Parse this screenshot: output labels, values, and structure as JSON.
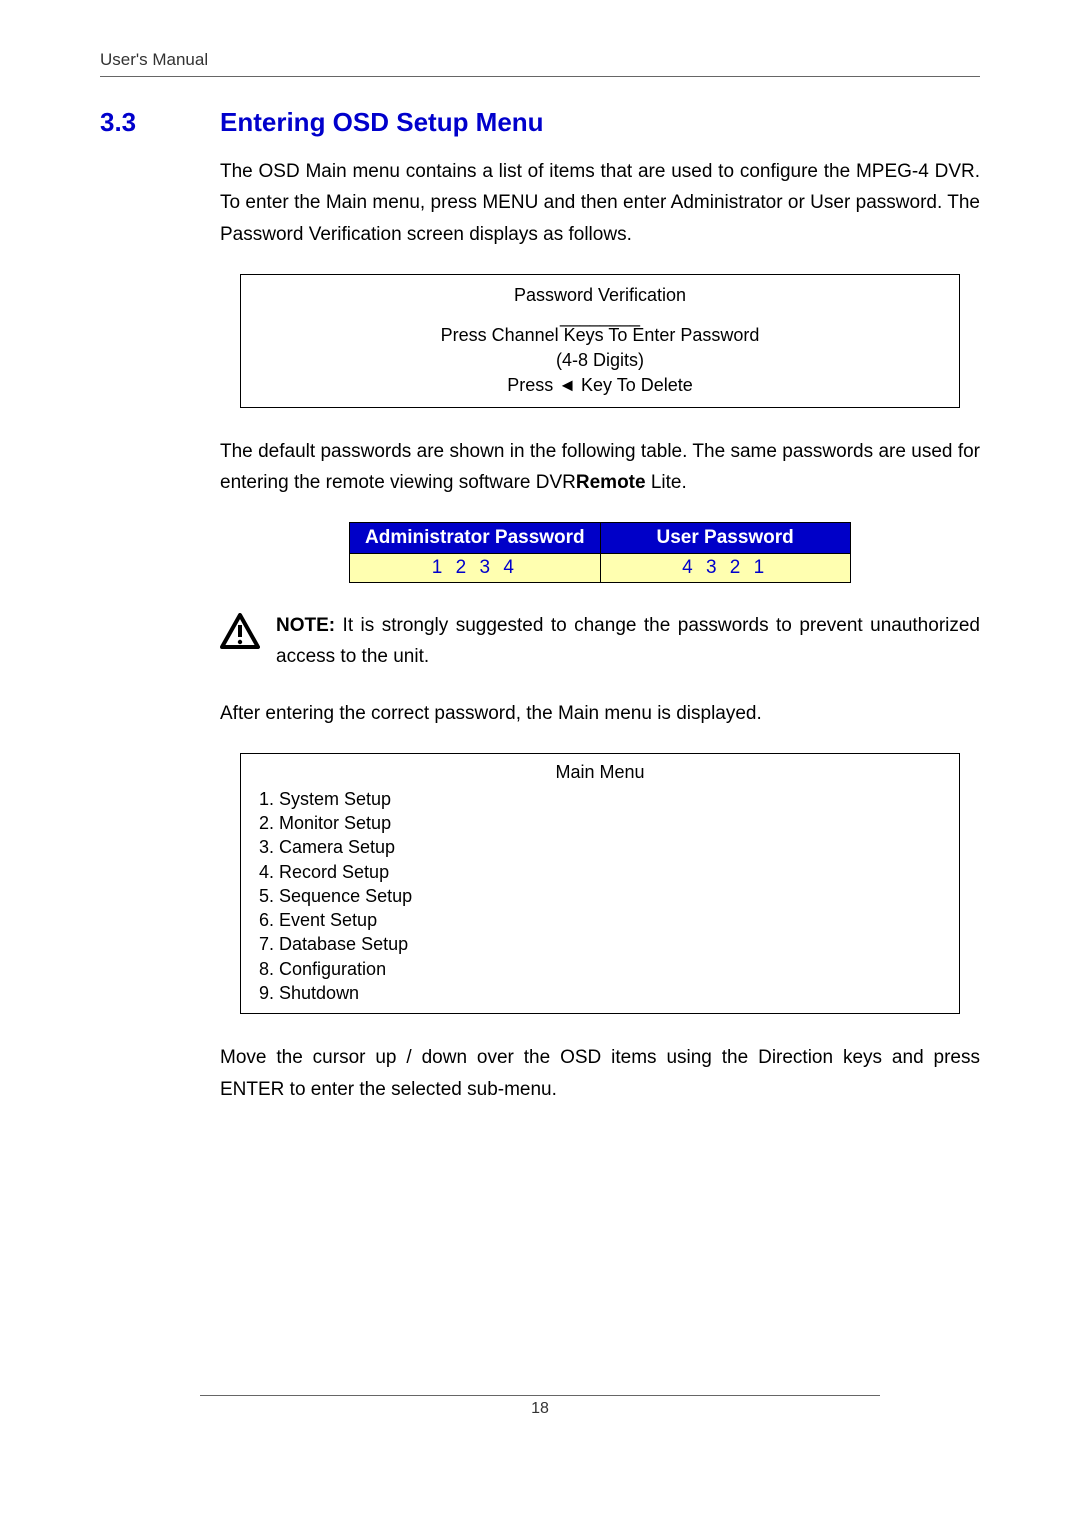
{
  "header": {
    "title": "User's Manual"
  },
  "section": {
    "number": "3.3",
    "title": "Entering OSD Setup Menu"
  },
  "paragraphs": {
    "intro": "The OSD Main menu contains a list of items that are used to configure the MPEG-4 DVR. To enter the Main menu, press MENU and then enter Administrator or User password. The Password Verification screen displays as follows.",
    "defaults_pre": "The default passwords are shown in the following table. The same passwords are used for entering the remote viewing software DVR",
    "defaults_bold": "Remote",
    "defaults_post": " Lite.",
    "after_pw": "After entering the correct password, the Main menu is displayed.",
    "move_cursor": "Move the cursor up / down over the OSD items using the Direction keys and press ENTER to enter the selected sub-menu."
  },
  "osd_pw_box": {
    "title": "Password Verification",
    "underscore": "________",
    "line1": "Press Channel Keys To Enter Password",
    "line2": "(4-8 Digits)",
    "line3": "Press ◄ Key To Delete"
  },
  "password_table": {
    "headers": [
      "Administrator Password",
      "User Password"
    ],
    "values": [
      "1 2 3 4",
      "4 3 2 1"
    ]
  },
  "note": {
    "label": "NOTE:",
    "text": " It is strongly suggested to change the passwords to prevent unauthorized access to the unit."
  },
  "main_menu": {
    "title": "Main Menu",
    "items": [
      "1. System Setup",
      "2. Monitor Setup",
      "3. Camera Setup",
      "4. Record Setup",
      "5. Sequence Setup",
      "6. Event Setup",
      "7. Database Setup",
      "8. Configuration",
      "9. Shutdown"
    ]
  },
  "footer": {
    "page_number": "18"
  }
}
